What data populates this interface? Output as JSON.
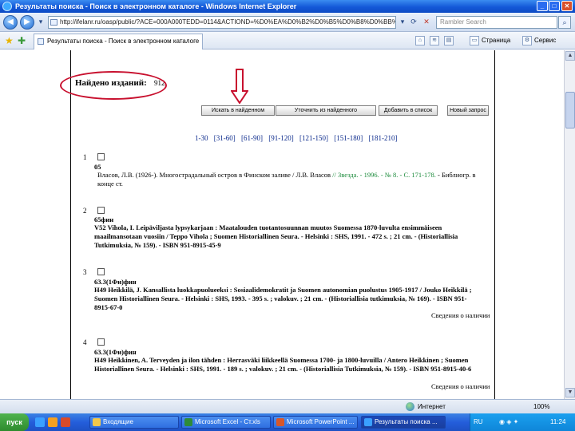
{
  "window": {
    "title": "Результаты поиска - Поиск в электронном каталоге - Windows Internet Explorer"
  },
  "address": {
    "url": "http://ifelanr.ru/oasp/public/?ACE=000A000TEDD=0114&ACTIOND=%D0%EA%D0%B2%D0%B5%D0%B8%D0%BB%D0%BA%D0%B",
    "search_placeholder": "Rambler Search"
  },
  "tab": {
    "label": "Результаты поиска - Поиск в электронном каталоге"
  },
  "commands": {
    "page_label": "Страница",
    "service_label": "Сервис"
  },
  "results": {
    "found_label": "Найдено изданий:",
    "found_count": "912"
  },
  "buttons": {
    "search_in_found": "Искать в найденном",
    "refine_in_found": "Уточнить из найденного",
    "add_to_list": "Добавить в список",
    "new_query": "Новый запрос"
  },
  "pagination": [
    "1-30",
    "[31-60]",
    "[61-90]",
    "[91-120]",
    "[121-150]",
    "[151-180]",
    "[181-210]"
  ],
  "records": [
    {
      "num": "1",
      "code": "05",
      "body": "Власов, Л.В. (1926-). Многострадальный остров в Финском заливе / Л.В. Власов",
      "link": "// Звезда. - 1996. - № 8. - С. 171-178.",
      "tail": "- Библиогр. в конце ст.",
      "availability": ""
    },
    {
      "num": "2",
      "code": "65фин",
      "body": "V52   Vihola, I. Leipäviljasta lypsykarjaan : Maatalouden tuotantosuunnan muutos Suomessa 1870-luvulta ensimmäiseen maailmansotaan vuosiin / Teppo Vihola ; Suomen Historiallinen Seura. - Helsinki : SHS, 1991. - 472 s. ; 21 cm. - (Historiallisia Tutkimuksia, № 159). - ISBN 951-8915-45-9",
      "link": "",
      "tail": "",
      "availability": ""
    },
    {
      "num": "3",
      "code": "63.3(1Фи)фин",
      "body": "H49   Heikkilä, J. Kansallista luokkapuolueeksi : Sosiaalidemokratit ja Suomen autonomian puolustus 1905-1917 / Jouko Heikkilä ; Suomen Historiallinen Seura. - Helsinki : SHS, 1993. - 395 s. ; valokuv. ; 21 cm. - (Historiallisia tutkimuksia, № 169). - ISBN 951-8915-67-0",
      "link": "",
      "tail": "",
      "availability": "Сведения о наличии"
    },
    {
      "num": "4",
      "code": "63.3(1Фи)фин",
      "body": "H49   Heikkinen, A. Terveyden ja ilon tähden : Herrasväki liikkeellä Suomessa 1700- ja 1800-luvuilla / Antero Heikkinen ; Suomen Historiallinen Seura. - Helsinki : SHS, 1991. - 189 s. ; valokuv. ; 21 cm. - (Historiallisia Tutkimuksia, № 159). - ISBN 951-8915-40-6",
      "link": "",
      "tail": "",
      "availability": "Сведения о наличии"
    }
  ],
  "status": {
    "zone": "Интернет",
    "zoom": "100%"
  },
  "taskbar": {
    "start": "пуск",
    "items": [
      "Входящие",
      "Microsoft Excel - Ст.xls",
      "Microsoft PowerPoint ...",
      "Результаты поиска ..."
    ],
    "lang": "RU",
    "clock": "11:24"
  },
  "icons": {
    "back": "back-arrow-icon",
    "forward": "forward-arrow-icon",
    "refresh": "refresh-icon",
    "stop": "stop-icon",
    "search": "search-icon",
    "favorites": "star-icon",
    "home": "home-icon",
    "annotation_arrow": "down-arrow-icon"
  },
  "colors": {
    "titlebar": "#1458d8",
    "annotation": "#c8102e",
    "link": "#1a8a3a",
    "pager": "#0b2a8c"
  }
}
